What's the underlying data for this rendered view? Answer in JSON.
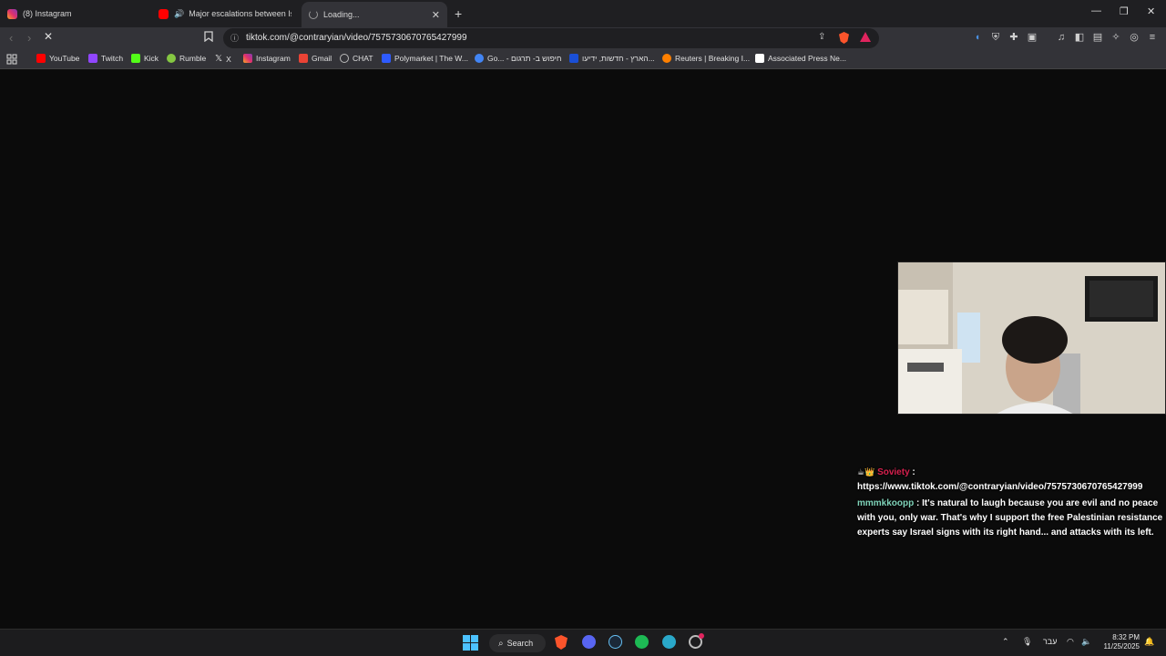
{
  "tabs": [
    {
      "label": "(8) Instagram",
      "icon": "instagram-icon"
    },
    {
      "label": "Major escalations between Israel",
      "icon": "youtube-icon"
    },
    {
      "label": "Loading...",
      "icon": "spinner-icon",
      "active": true
    }
  ],
  "address": {
    "url": "tiktok.com/@contraryian/video/7575730670765427999"
  },
  "bookmarks": [
    {
      "label": "YouTube",
      "color": "#ff0000"
    },
    {
      "label": "Twitch",
      "color": "#9146ff"
    },
    {
      "label": "Kick",
      "color": "#53fc18"
    },
    {
      "label": "Rumble",
      "color": "#85c742"
    },
    {
      "label": "X",
      "color": "#ffffff"
    },
    {
      "label": "Instagram",
      "color": "#e1306c"
    },
    {
      "label": "Gmail",
      "color": "#ea4335"
    },
    {
      "label": "CHAT",
      "color": "#bbbbbb"
    },
    {
      "label": "Polymarket | The W...",
      "color": "#2e5bff"
    },
    {
      "label": "Go... - חיפוש ב- תרגום",
      "color": "#4285f4"
    },
    {
      "label": "הארץ - חדשות, ידיעו...",
      "color": "#1a4fd6"
    },
    {
      "label": "Reuters | Breaking I...",
      "color": "#ff8000"
    },
    {
      "label": "Associated Press Ne...",
      "color": "#ffffff"
    }
  ],
  "chat": {
    "user1": "Soviety",
    "msg1": "https://www.tiktok.com/@contraryian/video/7575730670765427999",
    "user2": "mmmkkoopp",
    "msg2": "It's natural to laugh because you are evil and no peace with you, only war. That's why I support the free Palestinian resistance experts say Israel signs with its right hand... and attacks with its left."
  },
  "taskbar": {
    "search_label": "Search",
    "lang": "עבר",
    "time": "8:32 PM",
    "date": "11/25/2025"
  },
  "colors": {
    "brave": "#fb542b",
    "spotify": "#1db954"
  }
}
